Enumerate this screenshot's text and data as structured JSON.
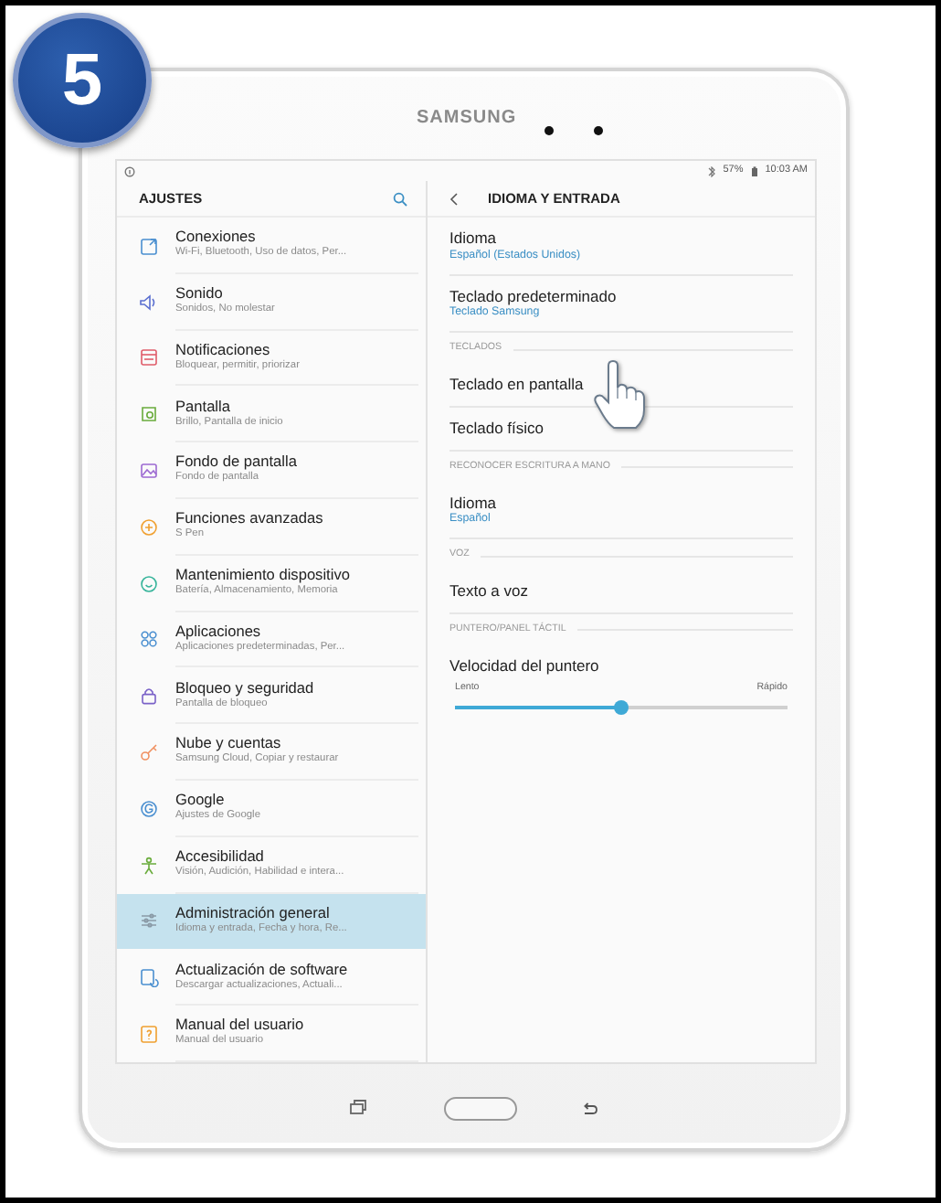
{
  "step_badge": "5",
  "device": {
    "brand": "SAMSUNG"
  },
  "status_bar": {
    "battery": "57%",
    "time": "10:03 AM"
  },
  "sidebar": {
    "title": "AJUSTES",
    "items": [
      {
        "title": "Conexiones",
        "subtitle": "Wi-Fi, Bluetooth, Uso de datos, Per...",
        "selected": false
      },
      {
        "title": "Sonido",
        "subtitle": "Sonidos, No molestar",
        "selected": false
      },
      {
        "title": "Notificaciones",
        "subtitle": "Bloquear, permitir, priorizar",
        "selected": false
      },
      {
        "title": "Pantalla",
        "subtitle": "Brillo, Pantalla de inicio",
        "selected": false
      },
      {
        "title": "Fondo de pantalla",
        "subtitle": "Fondo de pantalla",
        "selected": false
      },
      {
        "title": "Funciones avanzadas",
        "subtitle": "S Pen",
        "selected": false
      },
      {
        "title": "Mantenimiento dispositivo",
        "subtitle": "Batería, Almacenamiento, Memoria",
        "selected": false
      },
      {
        "title": "Aplicaciones",
        "subtitle": "Aplicaciones predeterminadas, Per...",
        "selected": false
      },
      {
        "title": "Bloqueo y seguridad",
        "subtitle": "Pantalla de bloqueo",
        "selected": false
      },
      {
        "title": "Nube y cuentas",
        "subtitle": "Samsung Cloud, Copiar y restaurar",
        "selected": false
      },
      {
        "title": "Google",
        "subtitle": "Ajustes de Google",
        "selected": false
      },
      {
        "title": "Accesibilidad",
        "subtitle": "Visión, Audición, Habilidad e intera...",
        "selected": false
      },
      {
        "title": "Administración general",
        "subtitle": "Idioma y entrada, Fecha y hora, Re...",
        "selected": true
      },
      {
        "title": "Actualización de software",
        "subtitle": "Descargar actualizaciones, Actuali...",
        "selected": false
      },
      {
        "title": "Manual del usuario",
        "subtitle": "Manual del usuario",
        "selected": false
      }
    ]
  },
  "detail": {
    "title": "IDIOMA Y ENTRADA",
    "rows": [
      {
        "kind": "setting",
        "title": "Idioma",
        "value": "Español (Estados Unidos)"
      },
      {
        "kind": "setting",
        "title": "Teclado predeterminado",
        "value": "Teclado Samsung"
      },
      {
        "kind": "section",
        "title": "TECLADOS"
      },
      {
        "kind": "setting",
        "title": "Teclado en pantalla"
      },
      {
        "kind": "setting",
        "title": "Teclado físico"
      },
      {
        "kind": "section",
        "title": "RECONOCER ESCRITURA A MANO"
      },
      {
        "kind": "setting",
        "title": "Idioma",
        "value": "Español"
      },
      {
        "kind": "section",
        "title": "VOZ"
      },
      {
        "kind": "setting",
        "title": "Texto a voz"
      },
      {
        "kind": "section",
        "title": "PUNTERO/PANEL TÁCTIL"
      },
      {
        "kind": "slider",
        "title": "Velocidad del puntero",
        "min_label": "Lento",
        "max_label": "Rápido",
        "level": 0.5
      }
    ]
  }
}
